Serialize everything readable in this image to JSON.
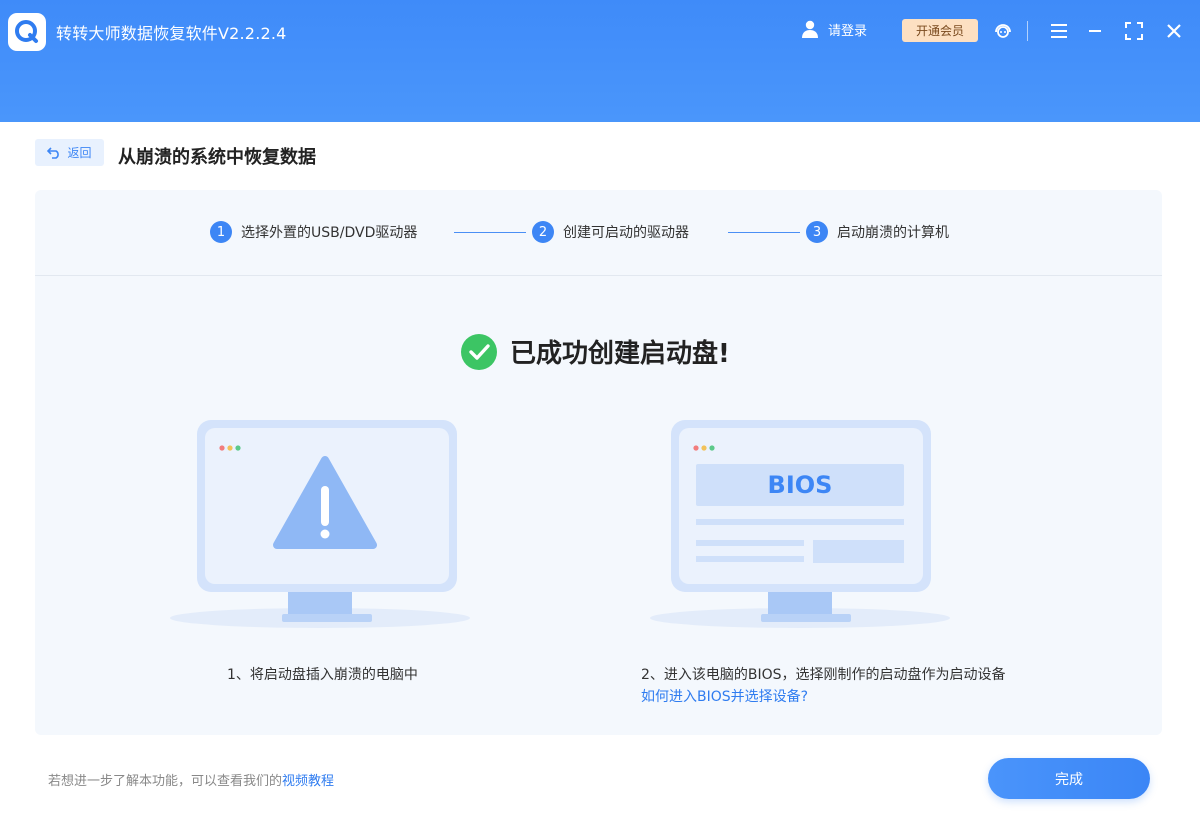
{
  "header": {
    "app_title": "转转大师数据恢复软件V2.2.2.4",
    "login_label": "请登录",
    "vip_label": "开通会员",
    "icons": [
      "user-icon",
      "support-icon",
      "menu-icon",
      "minimize-icon",
      "maximize-icon",
      "close-icon"
    ]
  },
  "topbar": {
    "back_label": "返回",
    "page_title": "从崩溃的系统中恢复数据"
  },
  "steps": [
    {
      "number": "1",
      "label": "选择外置的USB/DVD驱动器"
    },
    {
      "number": "2",
      "label": "创建可启动的驱动器"
    },
    {
      "number": "3",
      "label": "启动崩溃的计算机"
    }
  ],
  "success": {
    "message": "已成功创建启动盘!"
  },
  "instructions": {
    "left_caption": "1、将启动盘插入崩溃的电脑中",
    "right_caption": "2、进入该电脑的BIOS，选择刚制作的启动盘作为启动设备",
    "right_link": "如何进入BIOS并选择设备?",
    "bios_text": "BIOS"
  },
  "footer": {
    "hint_text": "若想进一步了解本功能，可以查看我们的",
    "hint_link": "视频教程",
    "done_label": "完成"
  },
  "colors": {
    "header_blue": "#3f8bf9",
    "accent": "#3d86f5",
    "success_green": "#3cc564",
    "vip_bg": "#fde0c2"
  }
}
